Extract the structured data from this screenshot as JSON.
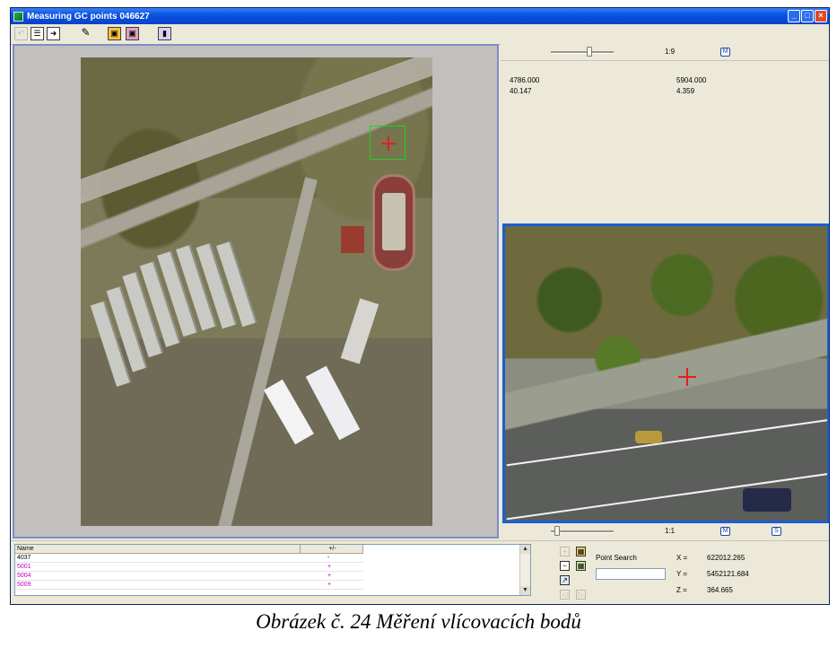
{
  "window": {
    "title": "Measuring GC points 046627"
  },
  "toolbar": {
    "buttons": [
      "undo-icon",
      "list-icon",
      "arrow-right-icon",
      "measure-icon",
      "image-icon",
      "image-alt-icon",
      "door-icon"
    ]
  },
  "upper_panel": {
    "scale": "1:9",
    "m_button": "M",
    "values": {
      "a1": "4786.000",
      "a2": "5904.000",
      "b1": "40.147",
      "b2": "4.359"
    }
  },
  "lower_zoom_bar": {
    "scale": "1:1",
    "m_button": "M",
    "s_button": "S"
  },
  "table": {
    "headers": [
      "Name",
      "+/-"
    ],
    "rows": [
      {
        "name": "4037",
        "sign": "-",
        "color": "#000000"
      },
      {
        "name": "5001",
        "sign": "+",
        "color": "#c000c0"
      },
      {
        "name": "5004",
        "sign": "+",
        "color": "#c000c0"
      },
      {
        "name": "5009",
        "sign": "+",
        "color": "#c000c0"
      }
    ]
  },
  "search": {
    "label": "Point Search",
    "value": ""
  },
  "coords": {
    "x_label": "X =",
    "x_value": "622012.265",
    "y_label": "Y =",
    "y_value": "5452121.684",
    "z_label": "Z =",
    "z_value": "364.665"
  },
  "caption": "Obrázek č. 24 Měření vlícovacích bodů",
  "colors": {
    "title_bar": "#0a54e3",
    "active_border": "#1a5fd0",
    "point_pink": "#c000c0",
    "crosshair": "#e02020",
    "target_box": "#20d020"
  }
}
